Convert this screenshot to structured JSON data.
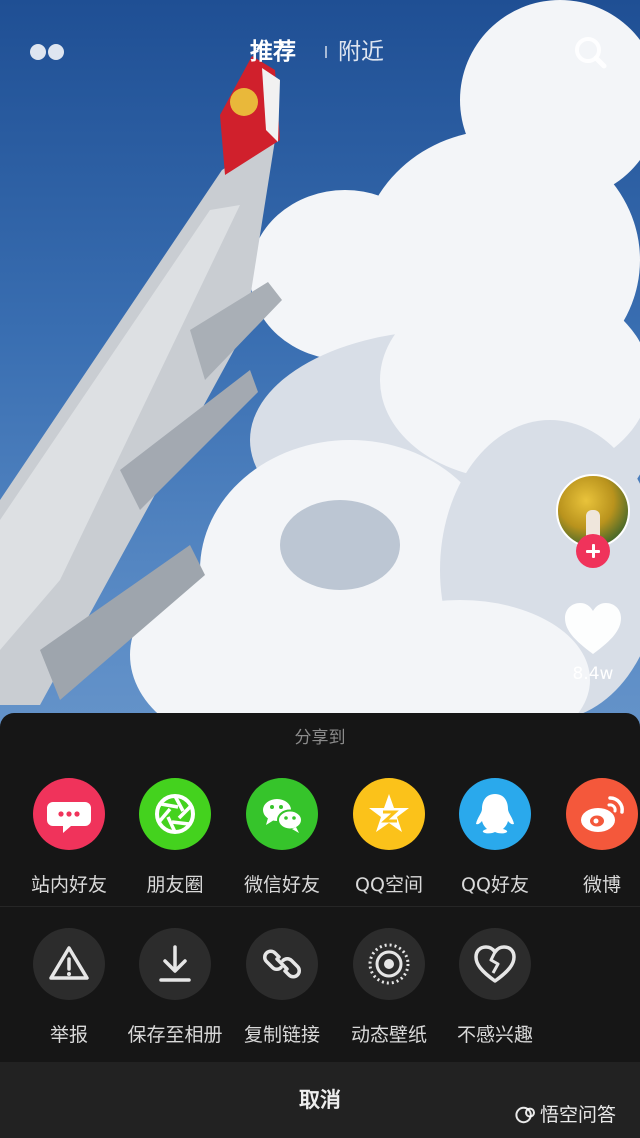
{
  "topbar": {
    "tab_recommended": "推荐",
    "tab_nearby": "附近"
  },
  "side": {
    "like_count": "8.4w"
  },
  "share": {
    "title": "分享到",
    "targets": [
      {
        "label": "站内好友",
        "color": "#f0335b",
        "icon": "chat-bubble-icon"
      },
      {
        "label": "朋友圈",
        "color": "#44d21e",
        "icon": "aperture-icon"
      },
      {
        "label": "微信好友",
        "color": "#36c42b",
        "icon": "wechat-icon"
      },
      {
        "label": "QQ空间",
        "color": "#fbc21a",
        "icon": "qzone-star-icon"
      },
      {
        "label": "QQ好友",
        "color": "#2aa9ec",
        "icon": "qq-penguin-icon"
      },
      {
        "label": "微博",
        "color": "#f4583b",
        "icon": "weibo-icon"
      }
    ],
    "actions": [
      {
        "label": "举报",
        "icon": "warning-icon"
      },
      {
        "label": "保存至相册",
        "icon": "download-icon"
      },
      {
        "label": "复制链接",
        "icon": "link-icon"
      },
      {
        "label": "动态壁纸",
        "icon": "live-wallpaper-icon"
      },
      {
        "label": "不感兴趣",
        "icon": "broken-heart-icon"
      }
    ],
    "cancel": "取消"
  },
  "watermark": "悟空问答"
}
